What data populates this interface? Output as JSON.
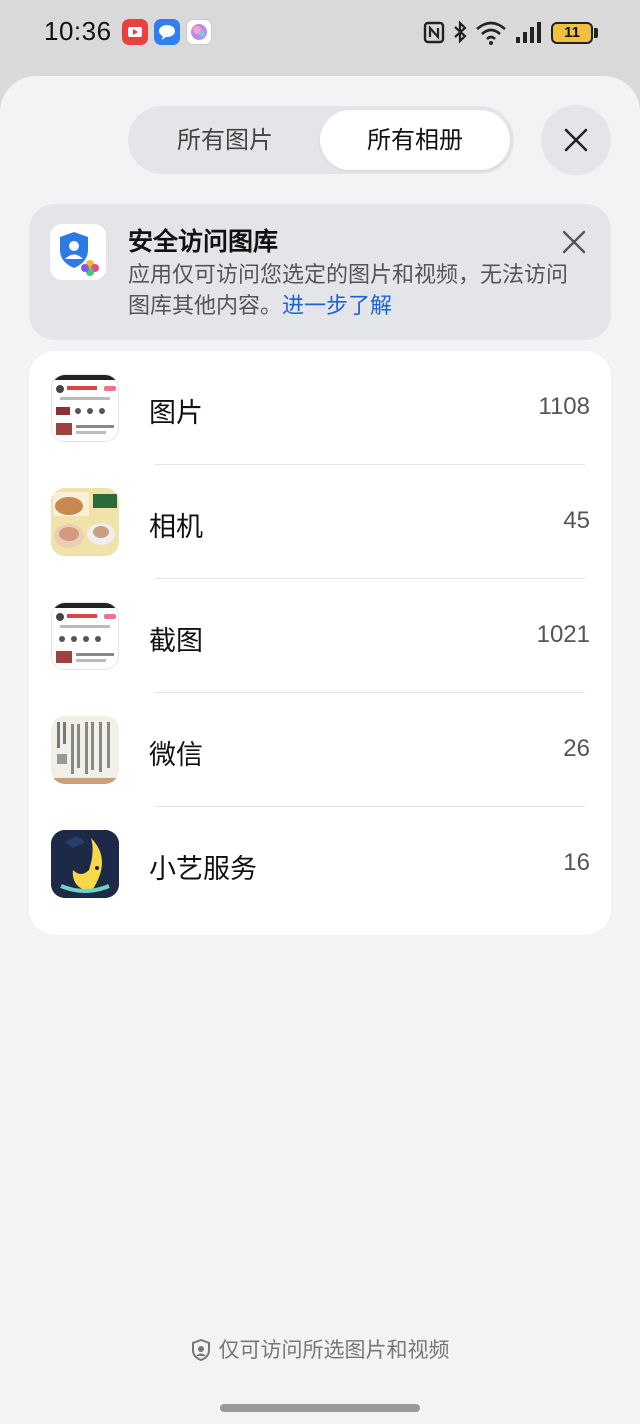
{
  "status_bar": {
    "time": "10:36",
    "battery": "11"
  },
  "tabs": [
    {
      "label": "所有图片",
      "active": false
    },
    {
      "label": "所有相册",
      "active": true
    }
  ],
  "banner": {
    "title": "安全访问图库",
    "text": "应用仅可访问您选定的图片和视频，无法访问图库其他内容。",
    "link": "进一步了解"
  },
  "albums": [
    {
      "name": "图片",
      "count": "1108"
    },
    {
      "name": "相机",
      "count": "45"
    },
    {
      "name": "截图",
      "count": "1021"
    },
    {
      "name": "微信",
      "count": "26"
    },
    {
      "name": "小艺服务",
      "count": "16"
    }
  ],
  "footer": {
    "text": "仅可访问所选图片和视频"
  },
  "colors": {
    "accent_link": "#1a63d8",
    "sheet_bg": "#f1f3f5"
  }
}
